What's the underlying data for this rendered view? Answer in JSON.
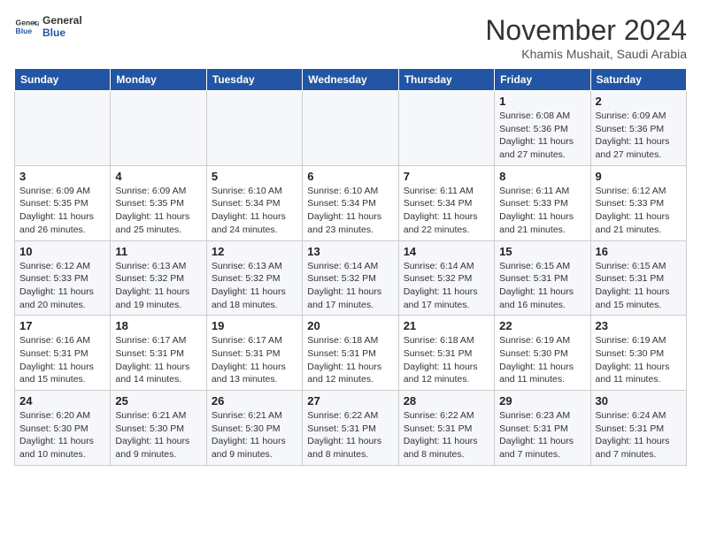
{
  "header": {
    "logo_line1": "General",
    "logo_line2": "Blue",
    "month": "November 2024",
    "location": "Khamis Mushait, Saudi Arabia"
  },
  "days_of_week": [
    "Sunday",
    "Monday",
    "Tuesday",
    "Wednesday",
    "Thursday",
    "Friday",
    "Saturday"
  ],
  "weeks": [
    [
      {
        "day": "",
        "info": ""
      },
      {
        "day": "",
        "info": ""
      },
      {
        "day": "",
        "info": ""
      },
      {
        "day": "",
        "info": ""
      },
      {
        "day": "",
        "info": ""
      },
      {
        "day": "1",
        "info": "Sunrise: 6:08 AM\nSunset: 5:36 PM\nDaylight: 11 hours and 27 minutes."
      },
      {
        "day": "2",
        "info": "Sunrise: 6:09 AM\nSunset: 5:36 PM\nDaylight: 11 hours and 27 minutes."
      }
    ],
    [
      {
        "day": "3",
        "info": "Sunrise: 6:09 AM\nSunset: 5:35 PM\nDaylight: 11 hours and 26 minutes."
      },
      {
        "day": "4",
        "info": "Sunrise: 6:09 AM\nSunset: 5:35 PM\nDaylight: 11 hours and 25 minutes."
      },
      {
        "day": "5",
        "info": "Sunrise: 6:10 AM\nSunset: 5:34 PM\nDaylight: 11 hours and 24 minutes."
      },
      {
        "day": "6",
        "info": "Sunrise: 6:10 AM\nSunset: 5:34 PM\nDaylight: 11 hours and 23 minutes."
      },
      {
        "day": "7",
        "info": "Sunrise: 6:11 AM\nSunset: 5:34 PM\nDaylight: 11 hours and 22 minutes."
      },
      {
        "day": "8",
        "info": "Sunrise: 6:11 AM\nSunset: 5:33 PM\nDaylight: 11 hours and 21 minutes."
      },
      {
        "day": "9",
        "info": "Sunrise: 6:12 AM\nSunset: 5:33 PM\nDaylight: 11 hours and 21 minutes."
      }
    ],
    [
      {
        "day": "10",
        "info": "Sunrise: 6:12 AM\nSunset: 5:33 PM\nDaylight: 11 hours and 20 minutes."
      },
      {
        "day": "11",
        "info": "Sunrise: 6:13 AM\nSunset: 5:32 PM\nDaylight: 11 hours and 19 minutes."
      },
      {
        "day": "12",
        "info": "Sunrise: 6:13 AM\nSunset: 5:32 PM\nDaylight: 11 hours and 18 minutes."
      },
      {
        "day": "13",
        "info": "Sunrise: 6:14 AM\nSunset: 5:32 PM\nDaylight: 11 hours and 17 minutes."
      },
      {
        "day": "14",
        "info": "Sunrise: 6:14 AM\nSunset: 5:32 PM\nDaylight: 11 hours and 17 minutes."
      },
      {
        "day": "15",
        "info": "Sunrise: 6:15 AM\nSunset: 5:31 PM\nDaylight: 11 hours and 16 minutes."
      },
      {
        "day": "16",
        "info": "Sunrise: 6:15 AM\nSunset: 5:31 PM\nDaylight: 11 hours and 15 minutes."
      }
    ],
    [
      {
        "day": "17",
        "info": "Sunrise: 6:16 AM\nSunset: 5:31 PM\nDaylight: 11 hours and 15 minutes."
      },
      {
        "day": "18",
        "info": "Sunrise: 6:17 AM\nSunset: 5:31 PM\nDaylight: 11 hours and 14 minutes."
      },
      {
        "day": "19",
        "info": "Sunrise: 6:17 AM\nSunset: 5:31 PM\nDaylight: 11 hours and 13 minutes."
      },
      {
        "day": "20",
        "info": "Sunrise: 6:18 AM\nSunset: 5:31 PM\nDaylight: 11 hours and 12 minutes."
      },
      {
        "day": "21",
        "info": "Sunrise: 6:18 AM\nSunset: 5:31 PM\nDaylight: 11 hours and 12 minutes."
      },
      {
        "day": "22",
        "info": "Sunrise: 6:19 AM\nSunset: 5:30 PM\nDaylight: 11 hours and 11 minutes."
      },
      {
        "day": "23",
        "info": "Sunrise: 6:19 AM\nSunset: 5:30 PM\nDaylight: 11 hours and 11 minutes."
      }
    ],
    [
      {
        "day": "24",
        "info": "Sunrise: 6:20 AM\nSunset: 5:30 PM\nDaylight: 11 hours and 10 minutes."
      },
      {
        "day": "25",
        "info": "Sunrise: 6:21 AM\nSunset: 5:30 PM\nDaylight: 11 hours and 9 minutes."
      },
      {
        "day": "26",
        "info": "Sunrise: 6:21 AM\nSunset: 5:30 PM\nDaylight: 11 hours and 9 minutes."
      },
      {
        "day": "27",
        "info": "Sunrise: 6:22 AM\nSunset: 5:31 PM\nDaylight: 11 hours and 8 minutes."
      },
      {
        "day": "28",
        "info": "Sunrise: 6:22 AM\nSunset: 5:31 PM\nDaylight: 11 hours and 8 minutes."
      },
      {
        "day": "29",
        "info": "Sunrise: 6:23 AM\nSunset: 5:31 PM\nDaylight: 11 hours and 7 minutes."
      },
      {
        "day": "30",
        "info": "Sunrise: 6:24 AM\nSunset: 5:31 PM\nDaylight: 11 hours and 7 minutes."
      }
    ]
  ]
}
